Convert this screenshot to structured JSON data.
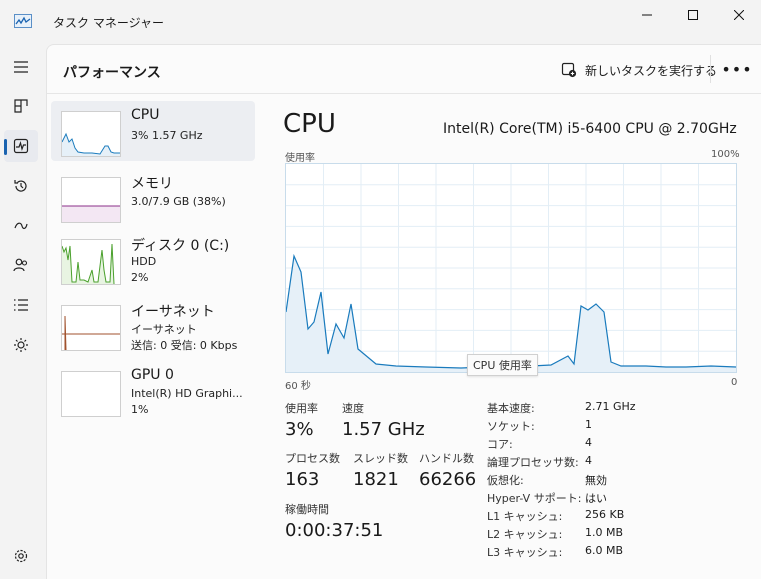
{
  "app": {
    "title": "タスク マネージャー"
  },
  "header": {
    "page_title": "パフォーマンス",
    "run_task_label": "新しいタスクを実行する"
  },
  "rail": [
    "menu-icon",
    "processes-icon",
    "performance-icon",
    "app-history-icon",
    "startup-apps-icon",
    "users-icon",
    "details-icon",
    "services-icon",
    "settings-icon"
  ],
  "devices": [
    {
      "name": "CPU",
      "sub1": "3%  1.57 GHz",
      "sub2": "",
      "color": "#1a7bbd"
    },
    {
      "name": "メモリ",
      "sub1": "3.0/7.9 GB (38%)",
      "sub2": "",
      "color": "#8b2f8a"
    },
    {
      "name": "ディスク 0 (C:)",
      "sub1": "HDD",
      "sub2": "2%",
      "color": "#4aa02c"
    },
    {
      "name": "イーサネット",
      "sub1": "イーサネット",
      "sub2": "送信: 0 受信: 0 Kbps",
      "color": "#a0522d"
    },
    {
      "name": "GPU 0",
      "sub1": "Intel(R) HD Graphi...",
      "sub2": "1%",
      "color": "#1a7bbd"
    }
  ],
  "detail": {
    "title": "CPU",
    "model": "Intel(R) Core(TM) i5-6400 CPU @ 2.70GHz",
    "usage_label": "使用率",
    "max_label": "100%",
    "time_left": "60 秒",
    "time_right": "0",
    "tooltip": "CPU 使用率",
    "stats": {
      "usage_label": "使用率",
      "usage_value": "3%",
      "speed_label": "速度",
      "speed_value": "1.57 GHz",
      "processes_label": "プロセス数",
      "processes_value": "163",
      "threads_label": "スレッド数",
      "threads_value": "1821",
      "handles_label": "ハンドル数",
      "handles_value": "66266",
      "uptime_label": "稼働時間",
      "uptime_value": "0:00:37:51"
    },
    "specs": [
      {
        "label": "基本速度:",
        "value": "2.71 GHz"
      },
      {
        "label": "ソケット:",
        "value": "1"
      },
      {
        "label": "コア:",
        "value": "4"
      },
      {
        "label": "論理プロセッサ数:",
        "value": "4"
      },
      {
        "label": "仮想化:",
        "value": "無効"
      },
      {
        "label": "Hyper-V サポート:",
        "value": "はい"
      },
      {
        "label": "L1 キャッシュ:",
        "value": "256 KB"
      },
      {
        "label": "L2 キャッシュ:",
        "value": "1.0 MB"
      },
      {
        "label": "L3 キャッシュ:",
        "value": "6.0 MB"
      }
    ]
  },
  "colors": {
    "cpu": "#1a7bbd",
    "cpu_fill": "#e6f0f8",
    "accent": "#1a63b0"
  }
}
